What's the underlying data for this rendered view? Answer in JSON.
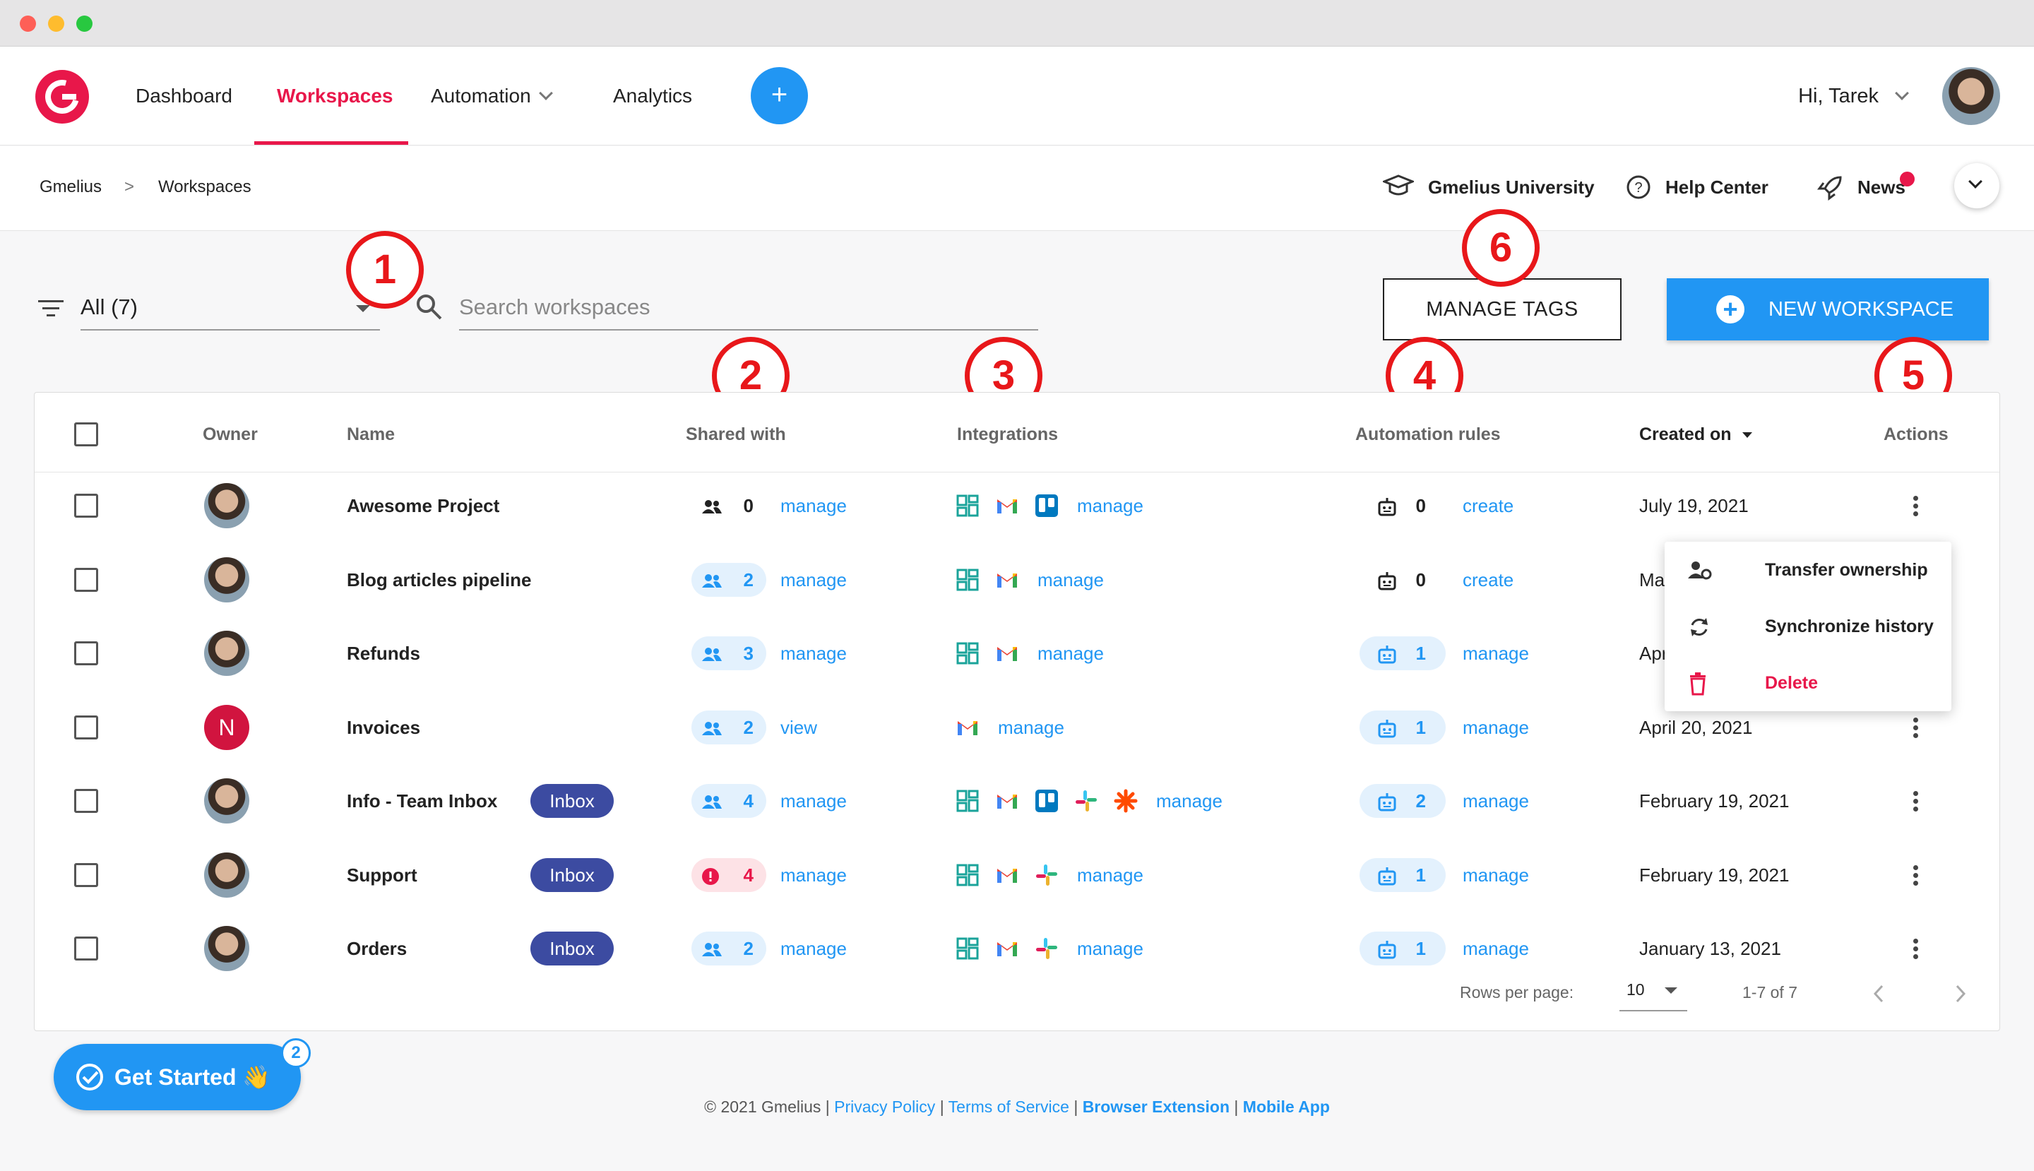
{
  "nav": {
    "dashboard": "Dashboard",
    "workspaces": "Workspaces",
    "automation": "Automation",
    "analytics": "Analytics",
    "add": "+",
    "greeting": "Hi, Tarek"
  },
  "breadcrumb": {
    "root": "Gmelius",
    "separator": ">",
    "current": "Workspaces"
  },
  "subnav": {
    "university": "Gmelius University",
    "help": "Help Center",
    "news": "News"
  },
  "toolbar": {
    "filter_value": "All (7)",
    "search_placeholder": "Search workspaces",
    "manage_tags": "MANAGE TAGS",
    "new_workspace": "NEW WORKSPACE",
    "new_icon": "+"
  },
  "callouts": [
    "1",
    "2",
    "3",
    "4",
    "5",
    "6"
  ],
  "table": {
    "headers": {
      "owner": "Owner",
      "name": "Name",
      "shared": "Shared with",
      "integrations": "Integrations",
      "automation": "Automation rules",
      "created": "Created on",
      "actions": "Actions"
    },
    "rows": [
      {
        "name": "Awesome Project",
        "tag": "",
        "shared": "0",
        "shared_style": "plain",
        "shared_link": "manage",
        "integrations": [
          "board",
          "gmail",
          "trello"
        ],
        "int_link": "manage",
        "rules": "0",
        "rules_style": "plain",
        "rules_link": "create",
        "created": "July 19, 2021",
        "owner": "photo"
      },
      {
        "name": "Blog articles pipeline",
        "tag": "",
        "shared": "2",
        "shared_style": "blue",
        "shared_link": "manage",
        "integrations": [
          "board",
          "gmail"
        ],
        "int_link": "manage",
        "rules": "0",
        "rules_style": "plain",
        "rules_link": "create",
        "created": "Ma",
        "owner": "photo"
      },
      {
        "name": "Refunds",
        "tag": "",
        "shared": "3",
        "shared_style": "blue",
        "shared_link": "manage",
        "integrations": [
          "board",
          "gmail"
        ],
        "int_link": "manage",
        "rules": "1",
        "rules_style": "blue",
        "rules_link": "manage",
        "created": "Apr",
        "owner": "photo"
      },
      {
        "name": "Invoices",
        "tag": "",
        "shared": "2",
        "shared_style": "blue",
        "shared_link": "view",
        "integrations": [
          "gmail"
        ],
        "int_link": "manage",
        "rules": "1",
        "rules_style": "blue",
        "rules_link": "manage",
        "created": "April 20, 2021",
        "owner": "N"
      },
      {
        "name": "Info - Team Inbox",
        "tag": "Inbox",
        "shared": "4",
        "shared_style": "blue",
        "shared_link": "manage",
        "integrations": [
          "board",
          "gmail",
          "trello",
          "slack",
          "zapier"
        ],
        "int_link": "manage",
        "rules": "2",
        "rules_style": "blue",
        "rules_link": "manage",
        "created": "February 19, 2021",
        "owner": "photo"
      },
      {
        "name": "Support",
        "tag": "Inbox",
        "shared": "4",
        "shared_style": "red",
        "shared_link": "manage",
        "integrations": [
          "board",
          "gmail",
          "slack"
        ],
        "int_link": "manage",
        "rules": "1",
        "rules_style": "blue",
        "rules_link": "manage",
        "created": "February 19, 2021",
        "owner": "photo"
      },
      {
        "name": "Orders",
        "tag": "Inbox",
        "shared": "2",
        "shared_style": "blue",
        "shared_link": "manage",
        "integrations": [
          "board",
          "gmail",
          "slack"
        ],
        "int_link": "manage",
        "rules": "1",
        "rules_style": "blue",
        "rules_link": "manage",
        "created": "January 13, 2021",
        "owner": "photo"
      }
    ],
    "pagination": {
      "rows_label": "Rows per page:",
      "rows_value": "10",
      "range": "1-7 of 7"
    }
  },
  "menu": {
    "transfer": "Transfer ownership",
    "sync": "Synchronize history",
    "delete": "Delete"
  },
  "get_started": {
    "label": "Get Started 👋",
    "badge": "2"
  },
  "footer": {
    "copyright": "© 2021 Gmelius",
    "privacy": "Privacy Policy",
    "terms": "Terms of Service",
    "extension": "Browser Extension",
    "mobile": "Mobile App",
    "sep": "|"
  },
  "colors": {
    "brand": "#e8174a",
    "accent": "#2196f3",
    "inbox_tag": "#3c4ba1"
  }
}
